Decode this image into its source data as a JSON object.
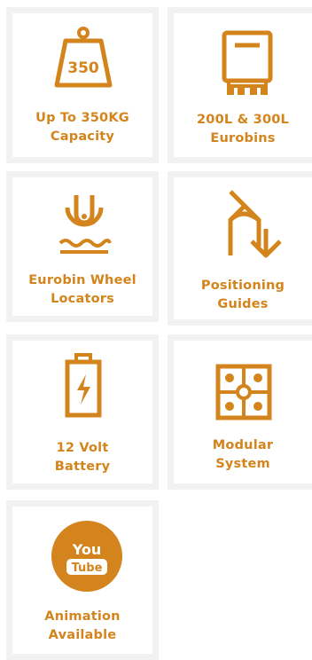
{
  "theme": {
    "accent": "#d4841c",
    "tile_border": "#f2f2f2"
  },
  "features": [
    {
      "icon": "weight-icon",
      "icon_text": "350",
      "line1": "Up To 350KG",
      "line2": "Capacity"
    },
    {
      "icon": "eurobin-icon",
      "line1": "200L & 300L",
      "line2": "Eurobins"
    },
    {
      "icon": "wheel-locator-icon",
      "line1": "Eurobin Wheel",
      "line2": "Locators"
    },
    {
      "icon": "positioning-arrow-icon",
      "line1": "Positioning",
      "line2": "Guides"
    },
    {
      "icon": "battery-icon",
      "line1": "12 Volt",
      "line2": "Battery"
    },
    {
      "icon": "puzzle-icon",
      "line1": "Modular",
      "line2": "System"
    },
    {
      "icon": "youtube-icon",
      "icon_top": "You",
      "icon_bottom": "Tube",
      "line1": "Animation",
      "line2": "Available"
    }
  ]
}
